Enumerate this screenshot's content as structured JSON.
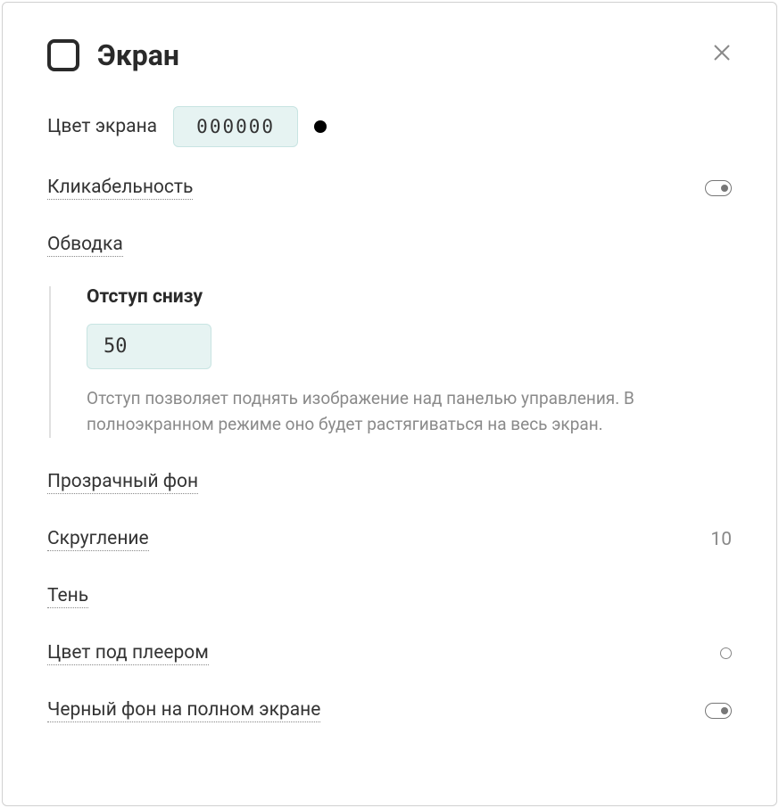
{
  "header": {
    "title": "Экран"
  },
  "screenColor": {
    "label": "Цвет экрана",
    "value": "000000",
    "swatch": "#000000"
  },
  "clickability": {
    "label": "Кликабельность",
    "state": "on"
  },
  "outline": {
    "label": "Обводка"
  },
  "bottomPadding": {
    "title": "Отступ снизу",
    "value": "50",
    "hint": "Отступ позволяет поднять изображение над панелью управления. В полноэкранном режиме оно будет растягиваться на весь экран."
  },
  "transparentBg": {
    "label": "Прозрачный фон"
  },
  "rounding": {
    "label": "Скругление",
    "value": "10"
  },
  "shadow": {
    "label": "Тень"
  },
  "underPlayerColor": {
    "label": "Цвет под плеером"
  },
  "fullscreenBlackBg": {
    "label": "Черный фон на полном экране",
    "state": "on"
  }
}
